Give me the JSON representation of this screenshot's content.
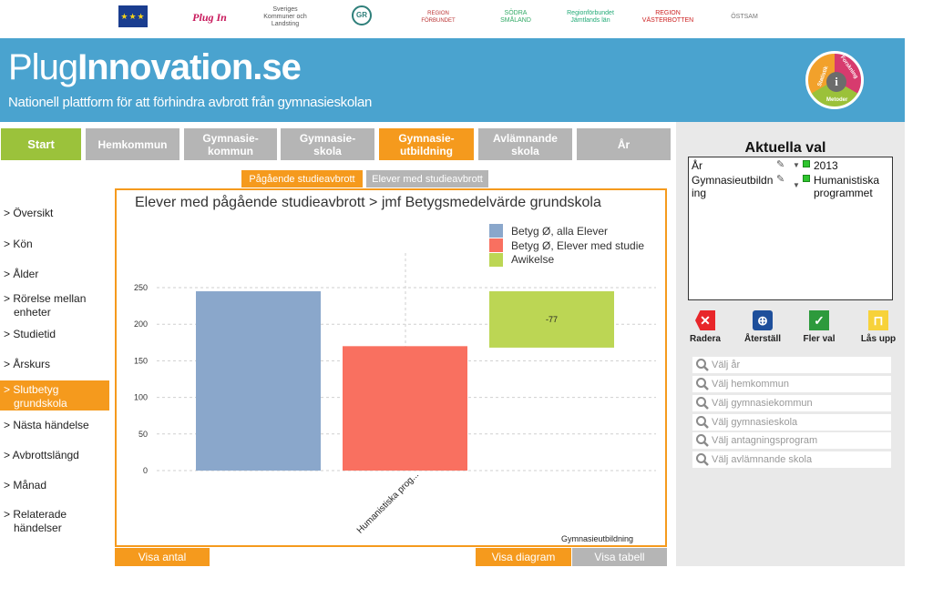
{
  "partner_logos": [
    {
      "name": "eu-flag-logo"
    },
    {
      "name": "plug-in-logo",
      "text": "Plug In"
    },
    {
      "name": "skl-logo",
      "text": "Sveriges Kommuner och Landsting"
    },
    {
      "name": "gr-logo",
      "text": "GR"
    },
    {
      "name": "region-logo",
      "text": "REGION FÖRBUNDET"
    },
    {
      "name": "sodra-smaland-logo",
      "text": "SÖDRA SMÅLAND"
    },
    {
      "name": "jamtlands-logo",
      "text": "Regionförbundet Jämtlands län"
    },
    {
      "name": "vasterbotten-logo",
      "text": "REGION VÄSTERBOTTEN"
    },
    {
      "name": "ostsam-logo",
      "text": "ÖSTSAM"
    }
  ],
  "header": {
    "brand_light": "Plug",
    "brand_bold": "Innovation.se",
    "tagline": "Nationell plattform för att förhindra avbrott från gymnasieskolan",
    "badge": {
      "left": "Statistik",
      "right": "Forskning",
      "bottom": "Metoder",
      "center": "i"
    }
  },
  "nav": {
    "start": "Start",
    "hemkommun": "Hemkommun",
    "gymnasiekommun": "Gymnasie-kommun",
    "gymnasieskola": "Gymnasie-skola",
    "gymnasieutbildning": "Gymnasie-utbildning",
    "avlamnande": "Avlämnande skola",
    "ar": "År"
  },
  "subtabs": {
    "active": "Pågående studieavbrott",
    "inactive": "Elever med studieavbrott"
  },
  "sidebar": {
    "items": [
      "> Översikt",
      "> Kön",
      "> Ålder",
      "> Rörelse mellan enheter",
      "> Studietid",
      "> Årskurs",
      "> Slutbetyg grundskola",
      "> Nästa händelse",
      "> Avbrottslängd",
      "> Månad",
      "> Relaterade händelser"
    ],
    "active_index": 6
  },
  "chart_data": {
    "type": "bar",
    "title": "Elever med pågående studieavbrott > jmf Betygsmedelvärde grundskola",
    "xlabel": "Gymnasieutbildning",
    "ylabel": "",
    "ylim": [
      0,
      250
    ],
    "yticks": [
      0,
      50,
      100,
      150,
      200,
      250
    ],
    "categories": [
      "Humanistiska programmet"
    ],
    "x_tick_label": "Humanistiska prog...",
    "series": [
      {
        "name": "Betyg Ø, alla Elever",
        "color": "#8aa7cb",
        "values": [
          245
        ]
      },
      {
        "name": "Betyg Ø, Elever med studie",
        "color": "#f97060",
        "values": [
          170
        ]
      },
      {
        "name": "Awikelse",
        "color": "#bcd654",
        "values": [
          -77
        ],
        "range": [
          168,
          245
        ],
        "label": "-77"
      }
    ]
  },
  "bottom_buttons": {
    "visa_antal": "Visa antal",
    "visa_diagram": "Visa diagram",
    "visa_tabell": "Visa tabell"
  },
  "current_selections": {
    "title": "Aktuella val",
    "rows": [
      {
        "label": "År",
        "value": "2013"
      },
      {
        "label": "Gymnasieutbildning",
        "value": "Humanistiska programmet"
      }
    ]
  },
  "actions": {
    "radera": "Radera",
    "aterstall": "Återställ",
    "fler_val": "Fler val",
    "las_upp": "Lås upp"
  },
  "searches": [
    "Välj år",
    "Välj hemkommun",
    "Välj gymnasiekommun",
    "Välj gymnasieskola",
    "Välj antagningsprogram",
    "Välj avlämnande skola"
  ],
  "colors": {
    "banner": "#4aa3cf",
    "orange": "#f59a1d",
    "green": "#9bc23b",
    "gray_tab": "#b5b5b5"
  }
}
